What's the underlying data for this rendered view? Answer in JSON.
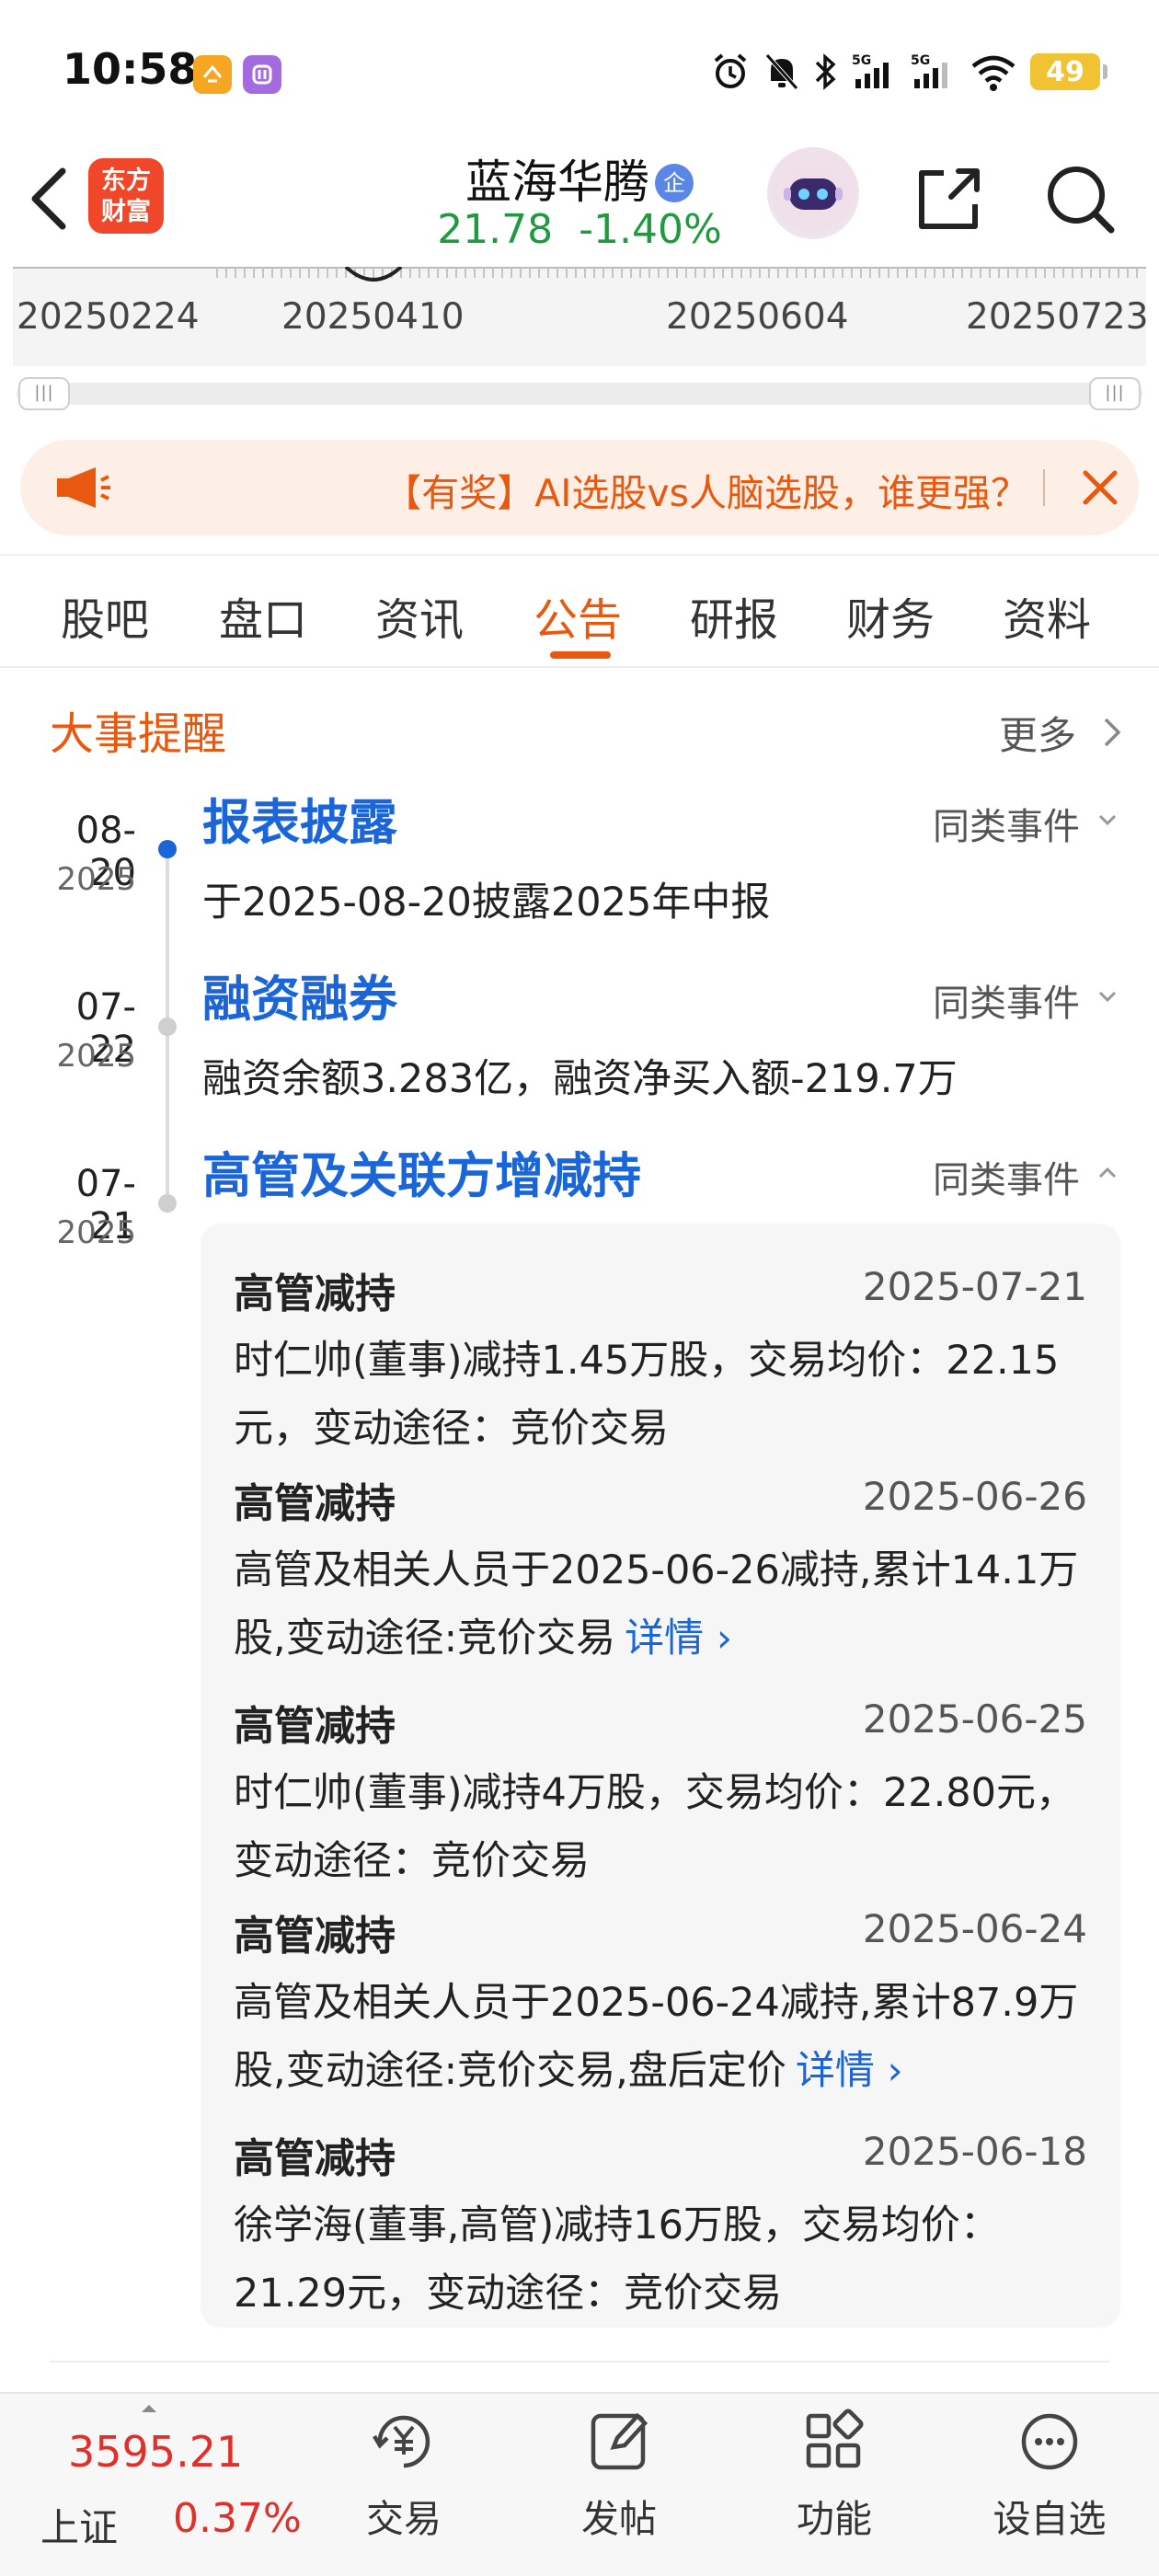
{
  "status_bar": {
    "time": "10:58",
    "battery": "49"
  },
  "header": {
    "logo_text": "东方财富",
    "stock_name": "蓝海华腾",
    "cert_badge": "企",
    "price": "21.78",
    "change_pct": "-1.40%"
  },
  "chart": {
    "axis_dates": [
      "20250224",
      "20250410",
      "20250604",
      "20250723"
    ]
  },
  "promo": {
    "text": "【有奖】AI选股vs人脑选股，谁更强？"
  },
  "tabs": [
    "股吧",
    "盘口",
    "资讯",
    "公告",
    "研报",
    "财务",
    "资料"
  ],
  "active_tab": "公告",
  "events_section": {
    "title": "大事提醒",
    "more": "更多",
    "events": [
      {
        "date": "08-20",
        "year": "2025",
        "title": "报表披露",
        "desc": "于2025-08-20披露2025年中报",
        "similar": "同类事件"
      },
      {
        "date": "07-22",
        "year": "2025",
        "title": "融资融券",
        "desc": "融资余额3.283亿，融资净买入额-219.7万",
        "similar": "同类事件"
      },
      {
        "date": "07-21",
        "year": "2025",
        "title": "高管及关联方增减持",
        "similar": "同类事件"
      }
    ],
    "details": [
      {
        "type": "高管减持",
        "date": "2025-07-21",
        "text": "时仁帅(董事)减持1.45万股，交易均价：22.15元，变动途径：竞价交易"
      },
      {
        "type": "高管减持",
        "date": "2025-06-26",
        "text": "高管及相关人员于2025-06-26减持,累计14.1万股,变动途径:竞价交易",
        "link": "详情"
      },
      {
        "type": "高管减持",
        "date": "2025-06-25",
        "text": "时仁帅(董事)减持4万股，交易均价：22.80元，变动途径：竞价交易"
      },
      {
        "type": "高管减持",
        "date": "2025-06-24",
        "text": "高管及相关人员于2025-06-24减持,累计87.9万股,变动途径:竞价交易,盘后定价",
        "link": "详情"
      },
      {
        "type": "高管减持",
        "date": "2025-06-18",
        "text": "徐学海(董事,高管)减持16万股，交易均价：21.29元，变动途径：竞价交易"
      }
    ]
  },
  "bottom_bar": {
    "index_value": "3595.21",
    "index_name": "上证",
    "index_change": "0.37%",
    "items": [
      "交易",
      "发帖",
      "功能",
      "设自选"
    ]
  },
  "colors": {
    "accent": "#e8580e",
    "link": "#1a66d9",
    "down": "#1f9a3e",
    "up": "#e0302a"
  }
}
